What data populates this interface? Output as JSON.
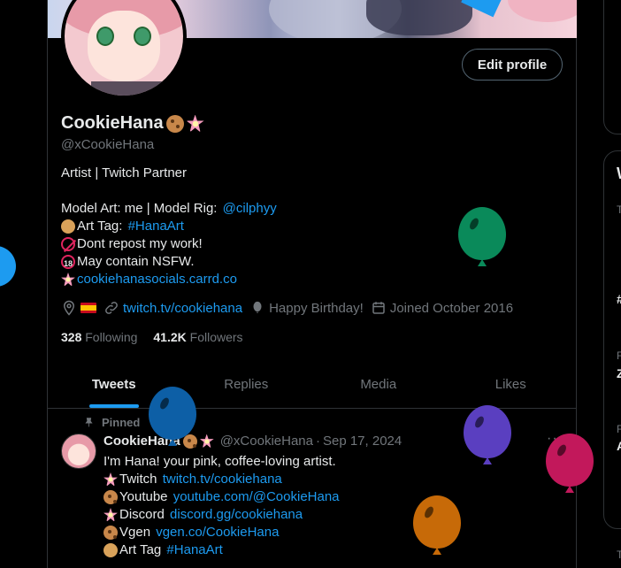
{
  "profile": {
    "name": "CookieHana",
    "handle": "@xCookieHana",
    "edit_button": "Edit profile",
    "bio": {
      "line1": "Artist | Twitch Partner",
      "model_prefix": "Model Art: me | Model Rig: ",
      "model_link": "@cilphyy",
      "tag_prefix": "Art Tag: ",
      "tag_link": "#HanaArt",
      "repost": "Dont repost my work!",
      "nsfw": "May contain NSFW.",
      "carrd_link": "cookiehanasocials.carrd.co"
    },
    "meta": {
      "url": "twitch.tv/cookiehana",
      "birthday": "Happy Birthday!",
      "joined": "Joined October 2016"
    },
    "following_count": "328",
    "following_label": "Following",
    "followers_count": "41.2K",
    "followers_label": "Followers"
  },
  "tabs": [
    "Tweets",
    "Replies",
    "Media",
    "Likes"
  ],
  "pinned_tweet": {
    "pinned_label": "Pinned",
    "author": "CookieHana",
    "handle": "@xCookieHana",
    "sep": "·",
    "date": "Sep 17, 2024",
    "more": "···",
    "intro": "I'm Hana! your pink, coffee-loving artist.",
    "links": [
      {
        "label": "Twitch ",
        "url": "twitch.tv/cookiehana",
        "icon": "flower-icon"
      },
      {
        "label": "Youtube ",
        "url": "youtube.com/@CookieHana",
        "icon": "cookie-icon"
      },
      {
        "label": "Discord ",
        "url": "discord.gg/cookiehana",
        "icon": "flower-icon"
      },
      {
        "label": "Vgen ",
        "url": "vgen.co/CookieHana",
        "icon": "cookie-icon"
      },
      {
        "label": "Art Tag ",
        "url": "#HanaArt",
        "icon": "palette-icon"
      }
    ]
  },
  "right_column": {
    "chars": [
      "W",
      "T",
      "#",
      "F",
      "Z",
      "F",
      "A",
      "T"
    ]
  },
  "colors": {
    "accent": "#1d9bf0",
    "balloon_green": "#0a8a5a",
    "balloon_blue": "#0d5fa6",
    "balloon_purple": "#5a3fc0",
    "balloon_magenta": "#c2185b",
    "balloon_orange": "#c76a08"
  }
}
